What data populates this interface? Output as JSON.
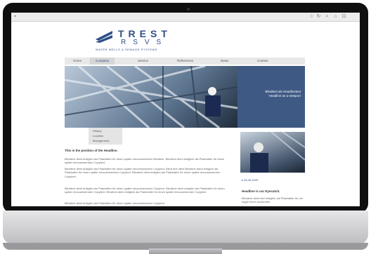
{
  "logo": {
    "line1": "TREST",
    "line2": "RSVS",
    "tagline": "WATER WELLS & SEWAGE SYSTEMS"
  },
  "nav": {
    "items": [
      "Home",
      "Company",
      "Service",
      "References",
      "News",
      "Contact"
    ],
    "active": "Company"
  },
  "dropdown": {
    "items": [
      "History",
      "Location",
      "Management"
    ]
  },
  "hero": {
    "box_line1": "Blindtext als Headlinetext",
    "box_line2": "Headline as a viewport"
  },
  "content": {
    "headline": "This is the position of the Headline.",
    "paragraphs": [
      "Blindtext dient lediglich als Platzhalter für einen später einzusetzenden Blindtext. Blindtext dient lediglich als Platzhalter für einen später einzusetzenden Copytext.",
      "Blindtext dient lediglich als Platzhalter für einen später einzusetzenden Copytext. Blind text dient Blindtext dient lediglich als Platzhalter für einen später einzusetzenden Copytext. Blindtext dient lediglich als Platzhalter für einen später einzusetzenden Copytext.",
      "Blindtext dient lediglich als Platzhalter für einen später einzusetzenden Copytext. Blindtext dient lediglich als Platzhalter für einen später einzusetzenden Copytext. Blindtext dient lediglich als Platzhalter für einen später einzusetzenden Copytext.",
      "Blindtext dient lediglich als Platzhalter für einen später einzusetzenden Copytext."
    ]
  },
  "sidebar": {
    "date": "▸ 05.05.2009",
    "headline": "Headline is our Eyecatch.",
    "text": "Blindtext dient hier lediglich als Platzhalter für ein sogar einen außerdem"
  },
  "colors": {
    "brand": "#2f4f86",
    "box": "#3e5a84",
    "nav": "#e8e8e8"
  }
}
